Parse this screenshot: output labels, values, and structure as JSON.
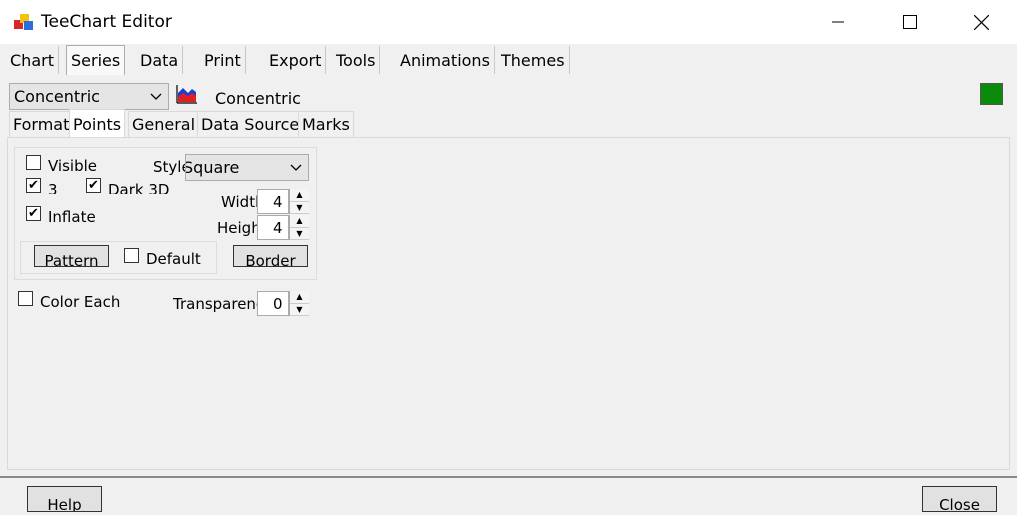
{
  "window": {
    "title": "TeeChart Editor",
    "minimize_glyph": "—",
    "maximize_glyph": "☐",
    "close_glyph": "✕"
  },
  "main_tabs": [
    "Chart",
    "Series",
    "Data",
    "Print",
    "Export",
    "Tools",
    "Animations",
    "Themes"
  ],
  "active_main_tab": "Series",
  "series_select": {
    "value": "Concentric"
  },
  "series_label": "Concentric",
  "series_color": "#0a8a0a",
  "sub_tabs": [
    "Format",
    "Points",
    "General",
    "Data Source",
    "Marks"
  ],
  "active_sub_tab": "Points",
  "points": {
    "visible": {
      "label": "Visible",
      "checked": false
    },
    "three_d": {
      "label": "3",
      "checked": true
    },
    "dark3d": {
      "label": "Dark 3D",
      "checked": true
    },
    "inflate": {
      "label": "Inflate",
      "checked": true
    },
    "style_label": "Style:",
    "style_value": "Square",
    "width_label": "Width:",
    "width_value": "4",
    "height_label": "Height:",
    "height_value": "4",
    "pattern_button": "Pattern",
    "default": {
      "label": "Default",
      "checked": false
    },
    "border_button": "Border",
    "color_each": {
      "label": "Color Each",
      "checked": false
    },
    "transparency_label": "Transparency:",
    "transparency_value": "0"
  },
  "footer": {
    "help_button": "Help",
    "close_button": "Close"
  },
  "icons": {
    "app": "teechart-app-icon",
    "series_type": "area-chart-icon",
    "dropdown": "chevron-down-icon"
  },
  "check_glyph": "✔"
}
